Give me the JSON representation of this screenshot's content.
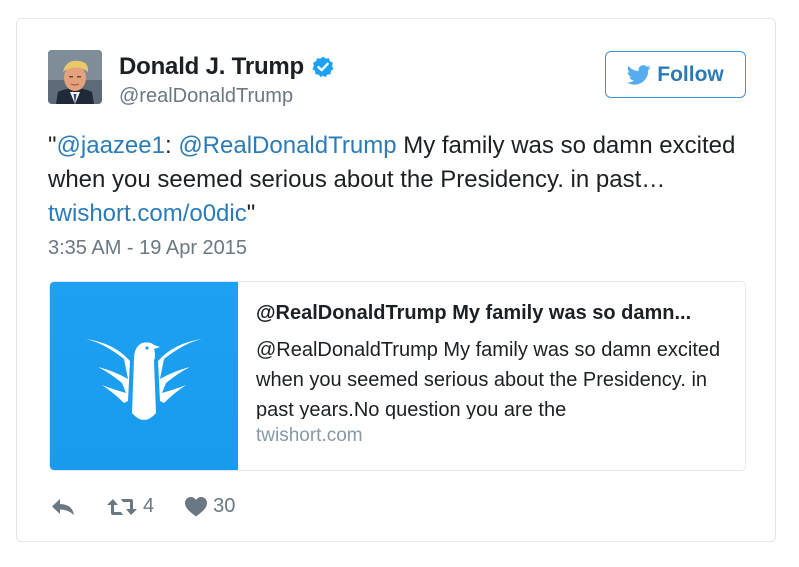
{
  "author": {
    "name": "Donald J. Trump",
    "handle": "@realDonaldTrump",
    "verified": true
  },
  "follow_button": {
    "label": "Follow"
  },
  "tweet": {
    "quote_open": "\"",
    "mention_1": "@jaazee1",
    "colon": ": ",
    "mention_2": "@RealDonaldTrump",
    "text_1": " My family was so damn excited when you seemed serious about the Presidency. in past… ",
    "link": "twishort.com/o0dic",
    "quote_close": "\"",
    "timestamp": "3:35 AM - 19 Apr 2015"
  },
  "card": {
    "title": "@RealDonaldTrump My family was so damn...",
    "description": "@RealDonaldTrump My family was so damn excited when you seemed serious about the Presidency. in past years.No question you are the",
    "domain": "twishort.com",
    "image_icon": "twishort-eagle-logo"
  },
  "actions": {
    "reply_icon": "reply-icon",
    "retweet_icon": "retweet-icon",
    "retweet_count": "4",
    "like_icon": "heart-icon",
    "like_count": "30"
  },
  "colors": {
    "link": "#2b7bb9",
    "verified": "#1da1f2",
    "card_image": "#1ea1f3",
    "muted": "#697882"
  }
}
